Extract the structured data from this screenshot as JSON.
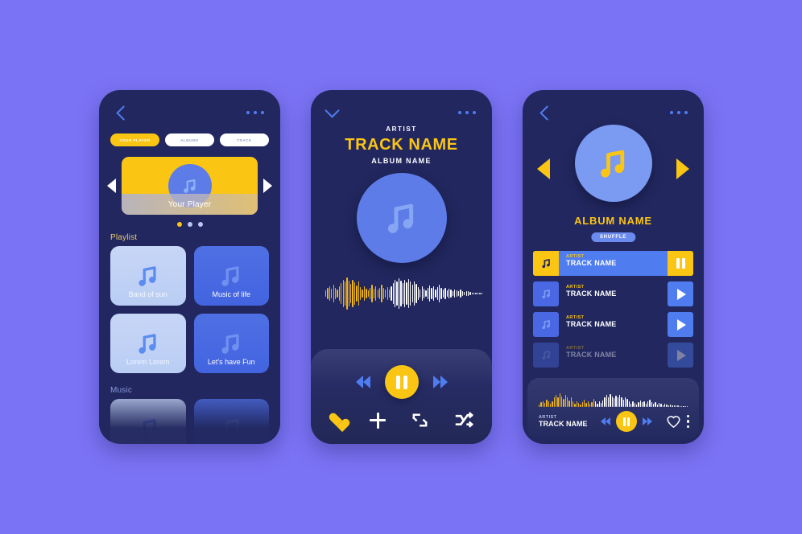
{
  "theme": {
    "page_bg": "#7b73f5",
    "card_bg": "#22285f",
    "accent_yellow": "#fbc513",
    "accent_blue": "#4f7df0",
    "art_blue": "#5d7ce8",
    "text_white": "#ffffff"
  },
  "screen1": {
    "back_icon": "chevron-left-icon",
    "menu_icon": "more-horizontal-icon",
    "tabs": [
      {
        "label": "YOUR PLAYER",
        "active": true
      },
      {
        "label": "ALBUMS",
        "active": false
      },
      {
        "label": "TRACK",
        "active": false
      }
    ],
    "carousel": {
      "prev_icon": "triangle-left-icon",
      "next_icon": "triangle-right-icon",
      "card_label": "Your Player",
      "card_icon": "music-note-icon",
      "dots": [
        true,
        false,
        false
      ]
    },
    "playlist_title": "Playlist",
    "playlist_tiles": [
      {
        "label": "Band of sun",
        "style": "light"
      },
      {
        "label": "Music of life",
        "style": "dark"
      },
      {
        "label": "Lorem Lorem",
        "style": "light"
      },
      {
        "label": "Let's have Fun",
        "style": "dark"
      }
    ],
    "music_title": "Music",
    "music_tiles": [
      {
        "label": "",
        "style": "light"
      },
      {
        "label": "",
        "style": "dark"
      }
    ]
  },
  "screen2": {
    "collapse_icon": "chevron-down-icon",
    "menu_icon": "more-horizontal-icon",
    "artist": "ARTIST",
    "track": "TRACK NAME",
    "album": "ALBUM NAME",
    "art_icon": "music-note-icon",
    "controls": {
      "prev_icon": "rewind-icon",
      "play_pause_icon": "pause-icon",
      "next_icon": "fast-forward-icon",
      "favorite_icon": "heart-filled-icon",
      "add_icon": "plus-icon",
      "repeat_icon": "repeat-icon",
      "shuffle_icon": "shuffle-icon"
    },
    "waveform": {
      "played_color": "#f0b51e",
      "remaining_color": "#ffffff",
      "played_count": 34,
      "heights": [
        6,
        10,
        14,
        9,
        16,
        11,
        7,
        13,
        20,
        26,
        22,
        30,
        24,
        18,
        26,
        21,
        15,
        22,
        12,
        8,
        14,
        9,
        6,
        11,
        16,
        9,
        13,
        7,
        10,
        17,
        11,
        7,
        12,
        8,
        14,
        20,
        26,
        22,
        28,
        24,
        19,
        25,
        21,
        27,
        23,
        17,
        22,
        18,
        12,
        8,
        13,
        9,
        6,
        11,
        15,
        10,
        14,
        8,
        12,
        16,
        11,
        7,
        10,
        6,
        9,
        7,
        5,
        8,
        6,
        4,
        7,
        5,
        3,
        5,
        4,
        3,
        2,
        2,
        2,
        1,
        1,
        1
      ]
    }
  },
  "screen3": {
    "back_icon": "chevron-left-icon",
    "menu_icon": "more-horizontal-icon",
    "prev_icon": "triangle-left-icon",
    "next_icon": "triangle-right-icon",
    "art_icon": "music-note-icon",
    "album": "ALBUM NAME",
    "shuffle_label": "SHUFFLE",
    "tracks": [
      {
        "artist": "ARTIST",
        "title": "TRACK NAME",
        "state": "active",
        "action_icon": "pause-icon"
      },
      {
        "artist": "ARTIST",
        "title": "TRACK NAME",
        "state": "norm",
        "action_icon": "play-icon"
      },
      {
        "artist": "ARTIST",
        "title": "TRACK NAME",
        "state": "norm",
        "action_icon": "play-icon"
      },
      {
        "artist": "ARTIST",
        "title": "TRACK NAME",
        "state": "faded",
        "action_icon": "play-icon"
      }
    ],
    "bottom_bar": {
      "artist": "ARTIST",
      "track": "TRACK NAME",
      "prev_icon": "rewind-icon",
      "play_pause_icon": "pause-icon",
      "next_icon": "fast-forward-icon",
      "favorite_icon": "heart-outline-icon",
      "menu_icon": "more-vertical-icon",
      "waveform": {
        "played_color": "#f0b51e",
        "remaining_color": "#ffffff",
        "played_count": 30,
        "heights": [
          4,
          7,
          9,
          6,
          11,
          8,
          5,
          9,
          14,
          18,
          15,
          20,
          16,
          12,
          18,
          14,
          10,
          15,
          8,
          5,
          9,
          6,
          4,
          7,
          11,
          6,
          9,
          5,
          7,
          12,
          8,
          5,
          8,
          6,
          10,
          14,
          18,
          15,
          19,
          16,
          13,
          17,
          14,
          18,
          15,
          11,
          15,
          12,
          8,
          5,
          9,
          6,
          4,
          7,
          10,
          7,
          9,
          5,
          8,
          11,
          7,
          5,
          7,
          4,
          6,
          5,
          3,
          5,
          4,
          3,
          4,
          3,
          2,
          2,
          2,
          1,
          1,
          1,
          1,
          1
        ]
      }
    }
  }
}
